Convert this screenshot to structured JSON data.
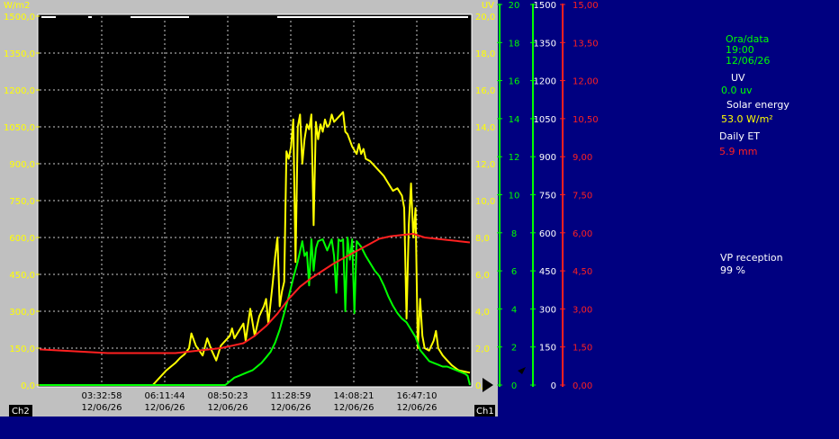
{
  "chart_data": {
    "type": "line",
    "left_axis": {
      "unit": "W/m2",
      "range": [
        0,
        1500
      ],
      "ticks": [
        "1500,0",
        "1350,0",
        "1200,0",
        "1050,0",
        "900,0",
        "750,0",
        "600,0",
        "450,0",
        "300,0",
        "150,0",
        "0,0"
      ]
    },
    "right_axis_1": {
      "unit": "UV",
      "range": [
        0,
        20
      ],
      "ticks": [
        "20,0",
        "18,0",
        "16,0",
        "14,0",
        "12,0",
        "10,0",
        "8,0",
        "6,0",
        "4,0",
        "2,0",
        "0,0"
      ]
    },
    "green_axis_uv": {
      "ticks": [
        "20",
        "18",
        "16",
        "14",
        "12",
        "10",
        "8",
        "6",
        "4",
        "2",
        "0"
      ]
    },
    "green_axis_solar": {
      "ticks": [
        "1500",
        "1350",
        "1200",
        "1050",
        "900",
        "750",
        "600",
        "450",
        "300",
        "150",
        "0"
      ]
    },
    "red_axis": {
      "ticks": [
        "15,00",
        "13,50",
        "12,00",
        "10,50",
        "9,00",
        "7,50",
        "6,00",
        "4,50",
        "3,00",
        "1,50",
        "0,00"
      ]
    },
    "x_ticks": [
      {
        "time": "03:32:58",
        "date": "12/06/26"
      },
      {
        "time": "06:11:44",
        "date": "12/06/26"
      },
      {
        "time": "08:50:23",
        "date": "12/06/26"
      },
      {
        "time": "11:28:59",
        "date": "12/06/26"
      },
      {
        "time": "14:08:21",
        "date": "12/06/26"
      },
      {
        "time": "16:47:10",
        "date": "12/06/26"
      }
    ],
    "channel_left": "Ch2",
    "channel_right": "Ch1",
    "x_range_hours": [
      0,
      19
    ],
    "series": [
      {
        "color": "#ffff00",
        "axis": "left",
        "x": [
          0,
          5.0,
          5.3,
          5.6,
          6.0,
          6.2,
          6.4,
          6.6,
          6.7,
          6.9,
          7.2,
          7.4,
          7.6,
          7.8,
          8.0,
          8.2,
          8.4,
          8.5,
          8.6,
          8.8,
          9.0,
          9.1,
          9.3,
          9.5,
          9.7,
          9.9,
          10.0,
          10.1,
          10.3,
          10.4,
          10.5,
          10.6,
          10.7,
          10.8,
          10.9,
          11.0,
          11.1,
          11.2,
          11.3,
          11.4,
          11.5,
          11.6,
          11.7,
          11.8,
          11.9,
          12.0,
          12.1,
          12.2,
          12.3,
          12.4,
          12.5,
          12.6,
          12.7,
          12.8,
          12.9,
          13.0,
          13.1,
          13.2,
          13.4,
          13.5,
          13.6,
          13.8,
          14.0,
          14.1,
          14.2,
          14.3,
          14.4,
          14.6,
          14.8,
          15.0,
          15.2,
          15.4,
          15.6,
          15.8,
          16.0,
          16.1,
          16.2,
          16.3,
          16.4,
          16.5,
          16.6,
          16.7,
          16.8,
          16.9,
          17.0,
          17.2,
          17.4,
          17.5,
          17.6,
          17.8,
          18.0,
          18.2,
          18.5,
          19.0
        ],
        "values": [
          0,
          0,
          30,
          60,
          90,
          110,
          125,
          150,
          210,
          160,
          120,
          190,
          140,
          100,
          160,
          180,
          200,
          230,
          190,
          220,
          250,
          180,
          310,
          200,
          280,
          320,
          350,
          250,
          420,
          520,
          600,
          320,
          380,
          420,
          950,
          920,
          970,
          1080,
          500,
          1050,
          1100,
          900,
          1000,
          1060,
          1040,
          1100,
          650,
          1070,
          1000,
          1060,
          1030,
          1080,
          1050,
          1060,
          1100,
          1070,
          1080,
          1090,
          1110,
          1030,
          1020,
          970,
          940,
          980,
          940,
          960,
          920,
          910,
          890,
          870,
          850,
          820,
          790,
          800,
          770,
          720,
          270,
          650,
          820,
          600,
          720,
          150,
          350,
          200,
          150,
          140,
          180,
          220,
          150,
          120,
          100,
          80,
          60,
          50
        ]
      },
      {
        "color": "#00ff00",
        "axis": "right_1",
        "x": [
          0,
          8.2,
          8.4,
          8.6,
          8.8,
          9.0,
          9.2,
          9.4,
          9.6,
          9.8,
          10.0,
          10.2,
          10.4,
          10.6,
          10.8,
          11.0,
          11.2,
          11.4,
          11.6,
          11.7,
          11.8,
          11.9,
          12.0,
          12.1,
          12.2,
          12.3,
          12.5,
          12.7,
          12.9,
          13.0,
          13.1,
          13.2,
          13.3,
          13.4,
          13.5,
          13.6,
          13.7,
          13.8,
          13.9,
          14.0,
          14.2,
          14.4,
          14.6,
          14.8,
          15.0,
          15.2,
          15.4,
          15.6,
          15.8,
          16.0,
          16.2,
          16.4,
          16.6,
          16.8,
          17.0,
          17.2,
          17.4,
          17.6,
          17.8,
          18.0,
          18.2,
          18.4,
          18.6,
          18.8,
          18.9,
          19.0
        ],
        "values": [
          0,
          0,
          0.2,
          0.4,
          0.5,
          0.6,
          0.7,
          0.8,
          1.0,
          1.2,
          1.5,
          1.8,
          2.3,
          3.0,
          3.9,
          4.8,
          5.8,
          6.7,
          7.8,
          7.0,
          7.2,
          5.4,
          7.9,
          6.2,
          7.4,
          7.8,
          7.9,
          7.3,
          7.9,
          7.0,
          5.0,
          7.9,
          7.8,
          7.9,
          4.0,
          8.0,
          6.8,
          7.9,
          3.9,
          7.8,
          7.5,
          7.0,
          6.6,
          6.2,
          5.9,
          5.4,
          4.8,
          4.3,
          3.9,
          3.6,
          3.4,
          3.0,
          2.6,
          1.9,
          1.6,
          1.3,
          1.2,
          1.1,
          1.0,
          1.0,
          0.9,
          0.8,
          0.7,
          0.6,
          0.5,
          0
        ]
      },
      {
        "color": "#ff2020",
        "axis": "red",
        "x": [
          0,
          1,
          2,
          3,
          4,
          5,
          6,
          7,
          8,
          9,
          9.5,
          10,
          10.5,
          11,
          11.5,
          12,
          12.5,
          13,
          13.5,
          14,
          14.5,
          15,
          15.5,
          16,
          16.5,
          17,
          17.5,
          18,
          18.5,
          19
        ],
        "values": [
          1.45,
          1.4,
          1.35,
          1.3,
          1.3,
          1.3,
          1.3,
          1.4,
          1.5,
          1.7,
          2.0,
          2.4,
          2.9,
          3.5,
          4.0,
          4.35,
          4.65,
          4.95,
          5.2,
          5.45,
          5.7,
          5.95,
          6.05,
          6.1,
          6.15,
          6.0,
          5.95,
          5.9,
          5.85,
          5.8
        ]
      }
    ]
  },
  "info": {
    "datetime_label": "Ora/data",
    "time": "19:00",
    "date": "12/06/26",
    "uv_label": "UV",
    "uv_value": "0.0 uv",
    "solar_label": "Solar energy",
    "solar_value": "53.0 W/m²",
    "et_label": "Daily ET",
    "et_value": "5.9 mm",
    "vp_label": "VP reception",
    "vp_value": "99 %"
  },
  "colors": {
    "yellow": "#ffff00",
    "green": "#00ff00",
    "red": "#ff2020",
    "background": "#000080"
  }
}
